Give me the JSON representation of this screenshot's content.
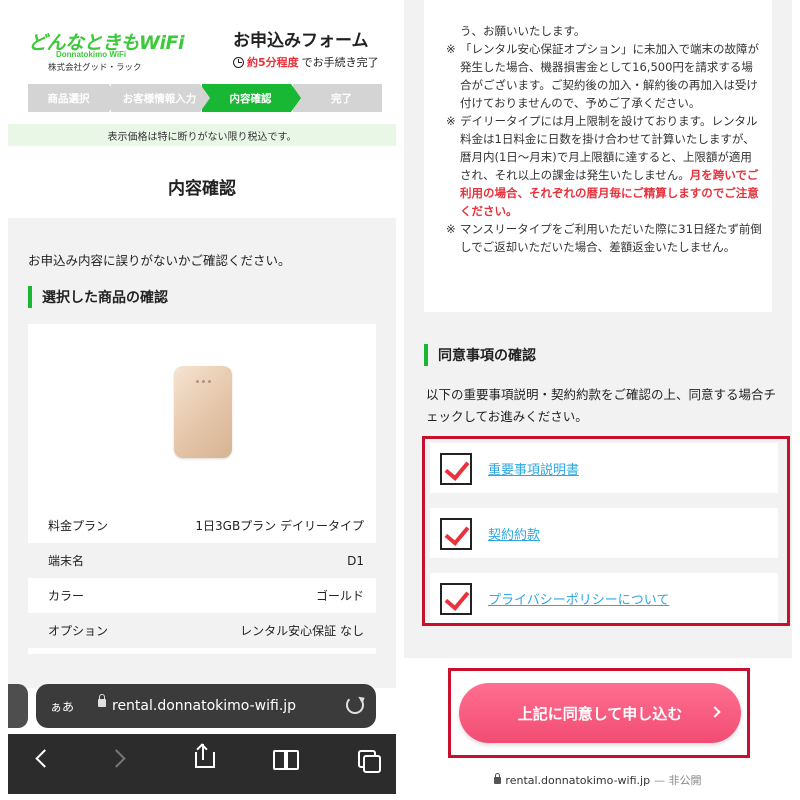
{
  "left": {
    "logo": {
      "name": "どんなときもWiFi",
      "sub": "Donnatokimo WiFi",
      "company": "株式会社グッド・ラック"
    },
    "header": {
      "title": "お申込みフォーム",
      "time_accent": "約5分程度",
      "time_suffix": "でお手続き完了"
    },
    "steps": [
      {
        "label": "商品選択",
        "active": false
      },
      {
        "label": "お客様情報入力",
        "active": false
      },
      {
        "label": "内容確認",
        "active": true
      },
      {
        "label": "完了",
        "active": false
      }
    ],
    "notice": "表示価格は特に断りがない限り税込です。",
    "page_title": "内容確認",
    "check_message": "お申込み内容に誤りがないかご確認ください。",
    "section_title": "選択した商品の確認",
    "specs": [
      {
        "label": "料金プラン",
        "value": "1日3GBプラン デイリータイプ"
      },
      {
        "label": "端末名",
        "value": "D1"
      },
      {
        "label": "カラー",
        "value": "ゴールド"
      },
      {
        "label": "オプション",
        "value": "レンタル安心保証 なし"
      }
    ],
    "browser": {
      "aa": "ぁあ",
      "url": "rental.donnatokimo-wifi.jp"
    }
  },
  "right": {
    "terms": {
      "line0": "う、お願いいたします。",
      "note1": "「レンタル安心保証オプション」に未加入で端末の故障が発生した場合、機器損害金として16,500円を請求する場合がございます。ご契約後の加入・解約後の再加入は受け付けておりませんので、予めご了承ください。",
      "note2": "デイリータイプには月上限制を設けております。レンタル料金は1日料金に日数を掛け合わせて計算いたしますが、暦月内(1日〜月末)で月上限額に達すると、上限額が適用され、それ以上の課金は発生いたしません。",
      "note2_red": "月を跨いでご利用の場合、それぞれの暦月毎にご精算しますのでご注意ください。",
      "note3": "マンスリータイプをご利用いただいた際に31日経たず前倒しでご返却いただいた場合、差額返金いたしません。",
      "mark": "※"
    },
    "agree_title": "同意事項の確認",
    "agree_desc": "以下の重要事項説明・契約約款をご確認の上、同意する場合チェックしてお進みください。",
    "checks": [
      {
        "label": "重要事項説明書",
        "checked": true
      },
      {
        "label": "契約約款",
        "checked": true
      },
      {
        "label": "プライバシーポリシーについて",
        "checked": true
      }
    ],
    "submit_label": "上記に同意して申し込む",
    "footer_url": "rental.donnatokimo-wifi.jp",
    "footer_private": "— 非公開"
  },
  "colors": {
    "brand_green": "#18b834",
    "accent_red": "#e8323c",
    "link_blue": "#2ea8e0",
    "submit_pink": "#f24c74",
    "highlight_frame": "#c8102e"
  }
}
